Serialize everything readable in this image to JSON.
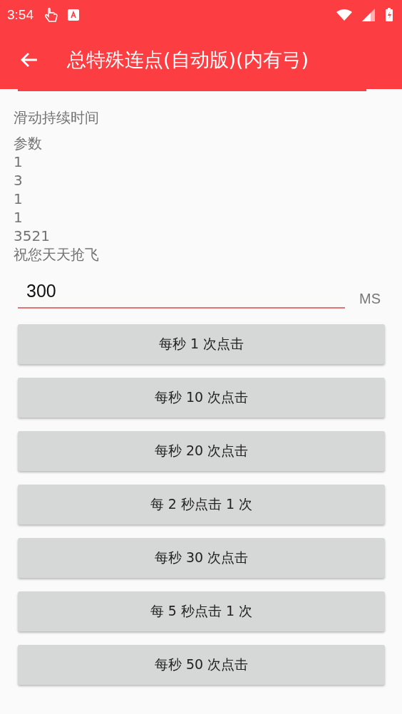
{
  "status_bar": {
    "time": "3:54"
  },
  "toolbar": {
    "title": "总特殊连点(自动版)(内有弓)"
  },
  "info_lines": [
    "滑动持续时间",
    "参数",
    "1",
    "3",
    "1",
    "1",
    "3521",
    "祝您天天抢飞"
  ],
  "duration_field": {
    "value": "300",
    "unit": "MS"
  },
  "buttons": [
    "每秒 1 次点击",
    "每秒 10 次点击",
    "每秒 20 次点击",
    "每 2 秒点击 1 次",
    "每秒 30 次点击",
    "每 5 秒点击 1 次",
    "每秒 50 次点击"
  ]
}
